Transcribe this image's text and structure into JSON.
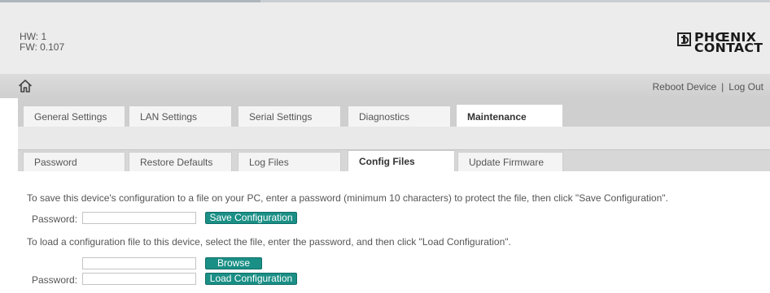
{
  "header": {
    "hw": "HW: 1",
    "fw": "FW: 0.107",
    "logo_line1": "PHŒNIX",
    "logo_line2": "CONTACT"
  },
  "nav": {
    "home_icon": "home-icon",
    "reboot_label": "Reboot Device",
    "separator": "|",
    "logout_label": "Log Out"
  },
  "main_tabs": [
    {
      "label": "General Settings",
      "active": false
    },
    {
      "label": "LAN Settings",
      "active": false
    },
    {
      "label": "Serial Settings",
      "active": false
    },
    {
      "label": "Diagnostics",
      "active": false
    },
    {
      "label": "Maintenance",
      "active": true
    }
  ],
  "sub_tabs": [
    {
      "label": "Password",
      "active": false
    },
    {
      "label": "Restore Defaults",
      "active": false
    },
    {
      "label": "Log Files",
      "active": false
    },
    {
      "label": "Config Files",
      "active": true
    },
    {
      "label": "Update Firmware",
      "active": false
    }
  ],
  "save_section": {
    "instructions": "To save this device's configuration to a file on your PC, enter a password (minimum 10 characters) to protect the file, then click \"Save Configuration\".",
    "password_label": "Password:",
    "password_value": "",
    "save_button": "Save Configuration"
  },
  "load_section": {
    "instructions": "To load a configuration file to this device, select the file, enter the password, and then click \"Load Configuration\".",
    "file_value": "",
    "browse_button": "Browse",
    "password_label": "Password:",
    "password_value": "",
    "load_button": "Load Configuration"
  },
  "colors": {
    "accent": "#1a8f86",
    "header_bg": "#ececec",
    "tab_bar_bg": "#cfcfcf"
  }
}
